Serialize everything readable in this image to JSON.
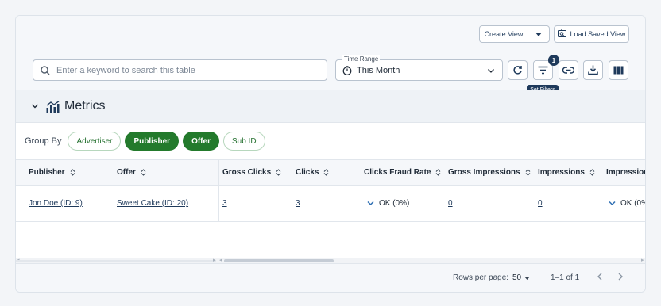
{
  "toolbar": {
    "create_view_label": "Create View",
    "load_saved_view_label": "Load Saved View",
    "search_placeholder": "Enter a keyword to search this table",
    "time_range_label": "Time Range",
    "time_range_value": "This Month",
    "filter_count": "1",
    "set_filters_tooltip": "Set Filters"
  },
  "section": {
    "title": "Metrics"
  },
  "group_by": {
    "label": "Group By",
    "options": [
      {
        "label": "Advertiser",
        "active": false
      },
      {
        "label": "Publisher",
        "active": true
      },
      {
        "label": "Offer",
        "active": true
      },
      {
        "label": "Sub ID",
        "active": false
      }
    ]
  },
  "table": {
    "columns": [
      "Publisher",
      "Offer",
      "Gross Clicks",
      "Clicks",
      "Clicks Fraud Rate",
      "Gross Impressions",
      "Impressions",
      "Impression"
    ],
    "rows": [
      {
        "publisher": "Jon Doe (ID: 9)",
        "offer": "Sweet Cake (ID: 20)",
        "gross_clicks": "3",
        "clicks": "3",
        "clicks_fraud_rate": "OK (0%)",
        "gross_impressions": "0",
        "impressions": "0",
        "impression_fraud_rate": "OK (0%"
      }
    ]
  },
  "pagination": {
    "rows_per_page_label": "Rows per page:",
    "rows_per_page_value": "50",
    "range_text": "1–1 of 1"
  },
  "colors": {
    "accent_green": "#237a2c",
    "navy": "#1f3a5b"
  }
}
